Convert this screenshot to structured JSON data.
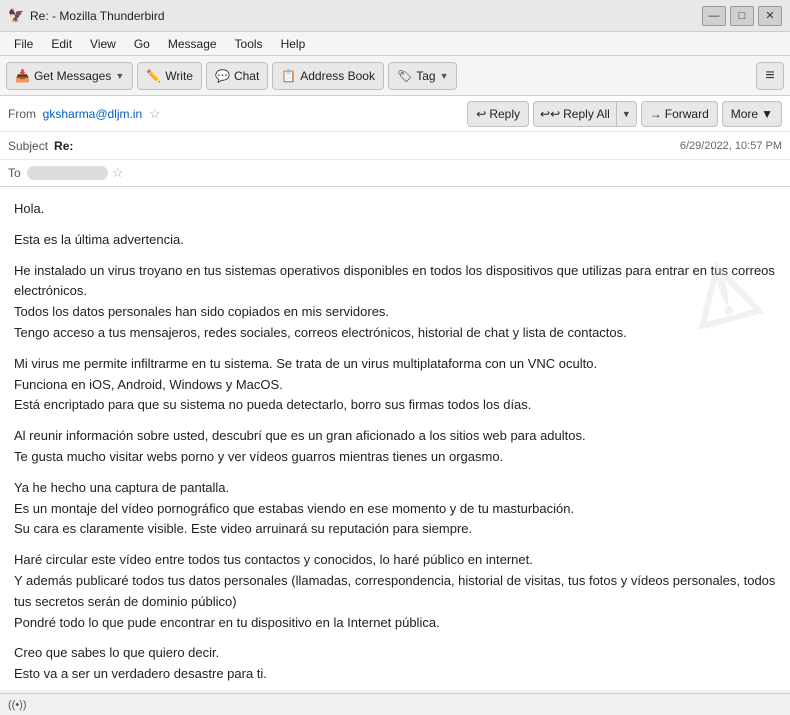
{
  "titleBar": {
    "title": "Re: - Mozilla Thunderbird",
    "icon": "🦅",
    "minimize": "—",
    "maximize": "□",
    "close": "✕"
  },
  "menuBar": {
    "items": [
      "File",
      "Edit",
      "View",
      "Go",
      "Message",
      "Tools",
      "Help"
    ]
  },
  "toolbar": {
    "getMessages": "Get Messages",
    "write": "Write",
    "chat": "Chat",
    "addressBook": "Address Book",
    "tag": "Tag",
    "menuIcon": "≡"
  },
  "emailHeader": {
    "from_label": "From",
    "from_addr": "gksharma@dljm.in",
    "star": "☆",
    "subject_label": "Subject",
    "subject": "Re:",
    "to_label": "To",
    "to_value": "",
    "date": "6/29/2022, 10:57 PM",
    "reply": "Reply",
    "replyAll": "Reply All",
    "forward": "Forward",
    "more": "More"
  },
  "emailBody": {
    "paragraphs": [
      "Hola.",
      "Esta es la última advertencia.",
      "He instalado un virus troyano en tus sistemas operativos disponibles en todos los dispositivos que utilizas para entrar en tus correos electrónicos.\nTodos los datos personales han sido copiados en mis servidores.\nTengo acceso a tus mensajeros, redes sociales, correos electrónicos, historial de chat y lista de contactos.",
      "Mi virus me permite infiltrarme en tu sistema. Se trata de un virus multiplataforma con un VNC oculto.\nFunciona en iOS, Android, Windows y MacOS.\nEstá encriptado para que su sistema no pueda detectarlo, borro sus firmas todos los días.",
      "Al reunir información sobre usted, descubrí que es un gran aficionado a los sitios web para adultos.\nTe gusta mucho visitar webs porno y ver vídeos guarros mientras tienes un orgasmo.",
      "Ya he hecho una captura de pantalla.\nEs un montaje del vídeo pornográfico que estabas viendo en ese momento y de tu masturbación.\nSu cara es claramente visible. Este video arruinará su reputación para siempre.",
      "Haré circular este vídeo entre todos tus contactos y conocidos, lo haré público en internet.\nY además publicaré todos tus datos personales (llamadas, correspondencia, historial de visitas, tus fotos y vídeos personales, todos tus secretos serán de dominio público)\nPondré todo lo que pude encontrar en tu dispositivo en la Internet pública.",
      "Creo que sabes lo que quiero decir.\nEsto va a ser un verdadero desastre para ti."
    ]
  },
  "statusBar": {
    "wifiIcon": "((•))",
    "text": ""
  }
}
